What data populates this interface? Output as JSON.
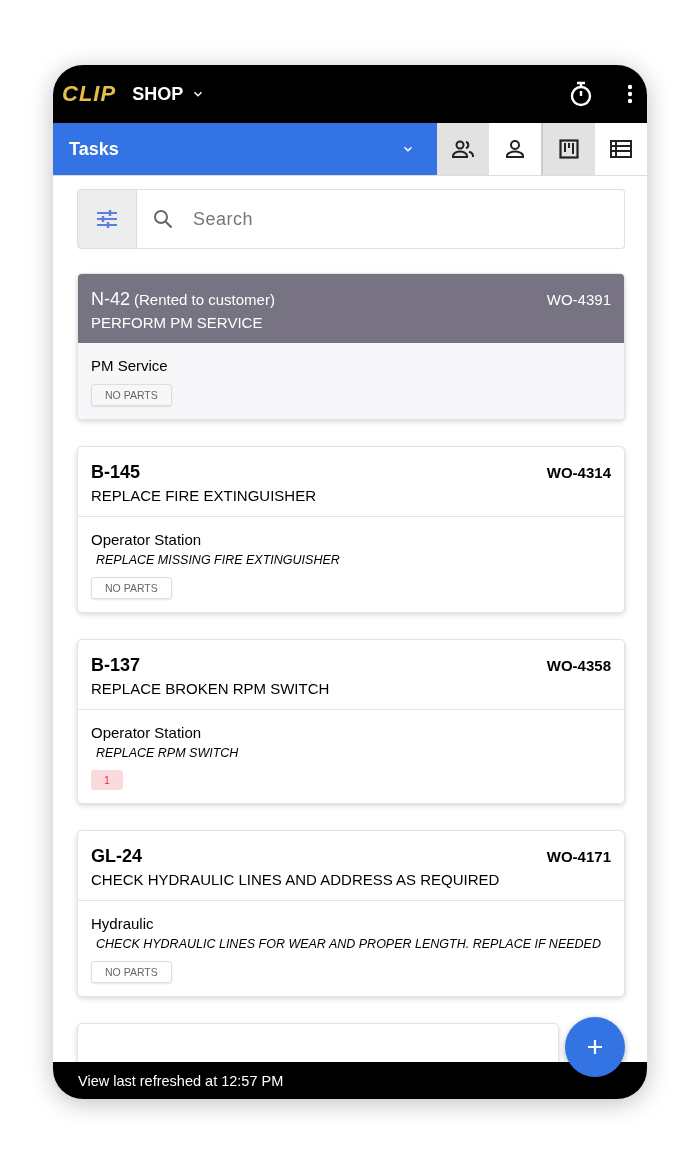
{
  "app_bar": {
    "logo": "CLIP",
    "location": "SHOP"
  },
  "toolbar": {
    "view_label": "Tasks",
    "scope_toggles": [
      {
        "kind": "team",
        "selected": true
      },
      {
        "kind": "person",
        "selected": false
      }
    ],
    "layout_toggles": [
      {
        "kind": "board",
        "selected": true
      },
      {
        "kind": "list",
        "selected": false
      }
    ]
  },
  "search": {
    "placeholder": "Search"
  },
  "cards": [
    {
      "unit": "N-42",
      "unit_note": "(Rented to customer)",
      "work_order": "WO-4391",
      "title": "PERFORM PM SERVICE",
      "selected": true,
      "section": "PM Service",
      "parts": {
        "kind": "none",
        "label": "NO PARTS"
      }
    },
    {
      "unit": "B-145",
      "work_order": "WO-4314",
      "title": "REPLACE FIRE EXTINGUISHER",
      "selected": false,
      "section": "Operator Station",
      "description": "REPLACE MISSING FIRE EXTINGUISHER",
      "parts": {
        "kind": "none",
        "label": "NO PARTS"
      }
    },
    {
      "unit": "B-137",
      "work_order": "WO-4358",
      "title": "REPLACE BROKEN RPM SWITCH",
      "selected": false,
      "section": "Operator Station",
      "description": "REPLACE RPM SWITCH",
      "parts": {
        "kind": "count",
        "label": "1"
      }
    },
    {
      "unit": "GL-24",
      "work_order": "WO-4171",
      "title": "CHECK HYDRAULIC LINES AND ADDRESS AS REQUIRED",
      "selected": false,
      "section": "Hydraulic",
      "description": "CHECK HYDRAULIC LINES FOR WEAR AND PROPER LENGTH. REPLACE IF NEEDED",
      "parts": {
        "kind": "none",
        "label": "NO PARTS"
      }
    }
  ],
  "footer": {
    "text": "View last refreshed at 12:57 PM"
  }
}
